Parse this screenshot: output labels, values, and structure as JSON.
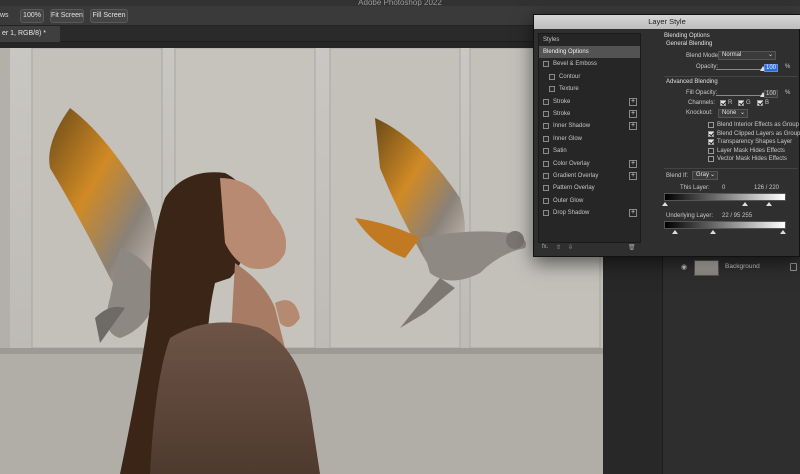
{
  "app": {
    "title": "Adobe Photoshop 2022"
  },
  "options_bar": {
    "partial_label": "ws",
    "zoom_button": "100%",
    "fit_screen_button": "Fit Screen",
    "fill_screen_button": "Fill Screen"
  },
  "document_tab": {
    "label": "er 1, RGB/8) *"
  },
  "layer_style_dialog": {
    "title": "Layer Style",
    "styles_header": "Styles",
    "styles": [
      {
        "label": "Blending Options",
        "checkbox": false,
        "plus": false,
        "active": true,
        "indent": 0
      },
      {
        "label": "Bevel & Emboss",
        "checkbox": true,
        "plus": false,
        "active": false,
        "indent": 0
      },
      {
        "label": "Contour",
        "checkbox": true,
        "plus": false,
        "active": false,
        "indent": 1
      },
      {
        "label": "Texture",
        "checkbox": true,
        "plus": false,
        "active": false,
        "indent": 1
      },
      {
        "label": "Stroke",
        "checkbox": true,
        "plus": true,
        "active": false,
        "indent": 0
      },
      {
        "label": "Stroke",
        "checkbox": true,
        "plus": true,
        "active": false,
        "indent": 0
      },
      {
        "label": "Inner Shadow",
        "checkbox": true,
        "plus": true,
        "active": false,
        "indent": 0
      },
      {
        "label": "Inner Glow",
        "checkbox": true,
        "plus": false,
        "active": false,
        "indent": 0
      },
      {
        "label": "Satin",
        "checkbox": true,
        "plus": false,
        "active": false,
        "indent": 0
      },
      {
        "label": "Color Overlay",
        "checkbox": true,
        "plus": true,
        "active": false,
        "indent": 0
      },
      {
        "label": "Gradient Overlay",
        "checkbox": true,
        "plus": true,
        "active": false,
        "indent": 0
      },
      {
        "label": "Pattern Overlay",
        "checkbox": true,
        "plus": false,
        "active": false,
        "indent": 0
      },
      {
        "label": "Outer Glow",
        "checkbox": true,
        "plus": false,
        "active": false,
        "indent": 0
      },
      {
        "label": "Drop Shadow",
        "checkbox": true,
        "plus": true,
        "active": false,
        "indent": 0
      }
    ],
    "footer": {
      "fx": "fx.",
      "up": "⇧",
      "down": "⇩",
      "trash": "🗑"
    },
    "blending": {
      "section_title": "Blending Options",
      "general_title": "General Blending",
      "blend_mode_label": "Blend Mode:",
      "blend_mode_value": "Normal",
      "opacity_label": "Opacity:",
      "opacity_value": "100",
      "percent": "%",
      "advanced_title": "Advanced Blending",
      "fill_opacity_label": "Fill Opacity:",
      "fill_opacity_value": "100",
      "channels_label": "Channels:",
      "channel_r": "R",
      "channel_g": "G",
      "channel_b": "B",
      "knockout_label": "Knockout:",
      "knockout_value": "None",
      "options": [
        {
          "label": "Blend Interior Effects as Group",
          "checked": false
        },
        {
          "label": "Blend Clipped Layers as Group",
          "checked": true
        },
        {
          "label": "Transparency Shapes Layer",
          "checked": true
        },
        {
          "label": "Layer Mask Hides Effects",
          "checked": false
        },
        {
          "label": "Vector Mask Hides Effects",
          "checked": false
        }
      ],
      "blend_if_label": "Blend If:",
      "blend_if_value": "Gray",
      "this_layer_label": "This Layer:",
      "this_layer_low": "0",
      "this_layer_high": "126  /  220",
      "underlying_label": "Underlying Layer:",
      "underlying_values": "22  /  95    255"
    }
  },
  "layers_panel": {
    "background_layer": "Background"
  }
}
